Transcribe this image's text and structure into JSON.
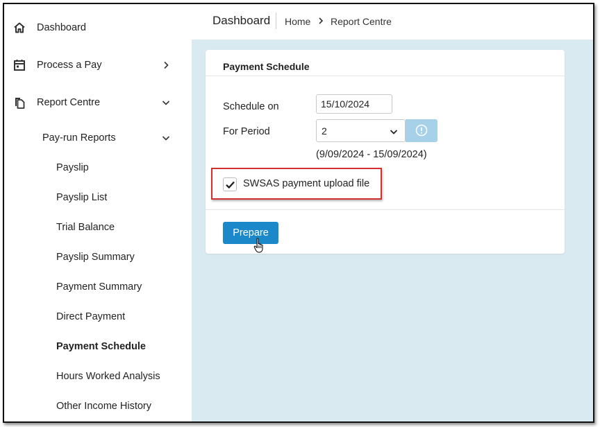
{
  "sidebar": {
    "dashboard": "Dashboard",
    "process_a_pay": "Process a Pay",
    "report_centre": "Report Centre",
    "pay_run_reports": "Pay-run Reports",
    "items": [
      "Payslip",
      "Payslip List",
      "Trial Balance",
      "Payslip Summary",
      "Payment Summary",
      "Direct Payment",
      "Payment Schedule",
      "Hours Worked Analysis",
      "Other Income History"
    ],
    "active_item": "Payment Schedule"
  },
  "topbar": {
    "title": "Dashboard",
    "breadcrumb_home": "Home",
    "breadcrumb_current": "Report Centre"
  },
  "card": {
    "title": "Payment Schedule",
    "schedule_on_label": "Schedule on",
    "schedule_on_value": "15/10/2024",
    "for_period_label": "For Period",
    "for_period_value": "2",
    "period_range": "(9/09/2024 - 15/09/2024)",
    "checkbox_label": "SWSAS payment upload file",
    "checkbox_checked": true,
    "prepare_label": "Prepare"
  },
  "colors": {
    "main_bg": "#d9eaf1",
    "primary_button": "#1a88c9",
    "info_button": "#a6d1e8",
    "highlight": "#d32f2f"
  }
}
